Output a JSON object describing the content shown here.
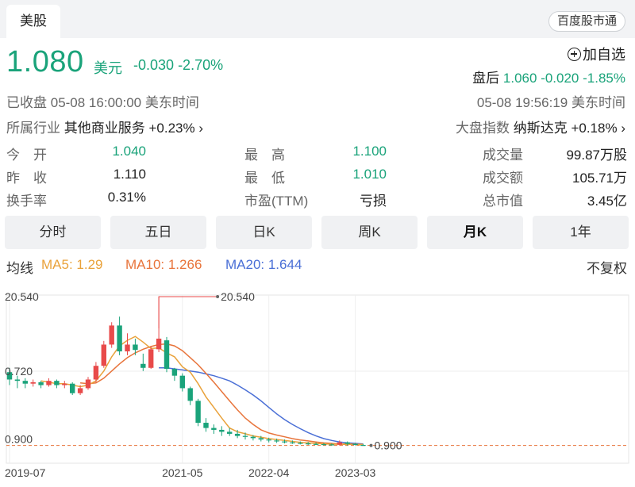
{
  "header": {
    "tab": "美股",
    "brand": "百度股市通"
  },
  "quote": {
    "price": "1.080",
    "unit": "美元",
    "change": "-0.030",
    "change_pct": "-2.70%",
    "watch_label": "加自选",
    "after_hours_label": "盘后",
    "after_hours_price": "1.060",
    "after_hours_change": "-0.020",
    "after_hours_pct": "-1.85%",
    "status": "已收盘",
    "close_time": "05-08 16:00:00",
    "tz": "美东时间",
    "after_time": "05-08 19:56:19",
    "after_tz": "美东时间"
  },
  "industry": {
    "label": "所属行业",
    "name": "其他商业服务",
    "change": "+0.23%",
    "arrow": "›"
  },
  "market_index": {
    "label": "大盘指数",
    "name": "纳斯达克",
    "change": "+0.18%",
    "arrow": "›"
  },
  "stats": {
    "open_label": "今　开",
    "open": "1.040",
    "high_label": "最　高",
    "high": "1.100",
    "volume_label": "成交量",
    "volume": "99.87万股",
    "prev_label": "昨　收",
    "prev": "1.110",
    "low_label": "最　低",
    "low": "1.010",
    "turnover_label": "成交额",
    "turnover": "105.71万",
    "turnover_rate_label": "换手率",
    "turnover_rate": "0.31%",
    "pe_label": "市盈(TTM)",
    "pe": "亏损",
    "mcap_label": "总市值",
    "mcap": "3.45亿"
  },
  "periods": [
    {
      "label": "分时",
      "active": false
    },
    {
      "label": "五日",
      "active": false
    },
    {
      "label": "日K",
      "active": false
    },
    {
      "label": "周K",
      "active": false
    },
    {
      "label": "月K",
      "active": true
    },
    {
      "label": "1年",
      "active": false
    }
  ],
  "ma": {
    "label": "均线",
    "ma5": "MA5: 1.29",
    "ma10": "MA10: 1.266",
    "ma20": "MA20: 1.644",
    "adjust": "不复权"
  },
  "colors": {
    "up": "#e84a4a",
    "down": "#1aa37a",
    "ma5": "#e9a23b",
    "ma10": "#e8743b",
    "ma20": "#4a6fd6"
  },
  "chart_data": {
    "type": "candlestick",
    "scale": "log",
    "y_ticks": [
      "20.540",
      "0.720",
      "0.900"
    ],
    "y_tick_values": [
      20.54,
      4.3,
      0.9
    ],
    "x_ticks": [
      "2019-07",
      "2021-05",
      "2022-04",
      "2023-03"
    ],
    "x_tick_index": [
      0,
      22,
      33,
      44
    ],
    "max_label": "20.540",
    "last_label": "0.900",
    "candles": [
      {
        "o": 4.2,
        "c": 3.6,
        "h": 4.6,
        "l": 3.2
      },
      {
        "o": 3.6,
        "c": 3.5,
        "h": 3.9,
        "l": 3.0
      },
      {
        "o": 3.5,
        "c": 3.3,
        "h": 3.7,
        "l": 3.0
      },
      {
        "o": 3.3,
        "c": 3.4,
        "h": 3.6,
        "l": 3.1
      },
      {
        "o": 3.4,
        "c": 3.2,
        "h": 3.5,
        "l": 3.0
      },
      {
        "o": 3.2,
        "c": 3.5,
        "h": 3.7,
        "l": 3.1
      },
      {
        "o": 3.5,
        "c": 3.2,
        "h": 3.6,
        "l": 3.0
      },
      {
        "o": 3.2,
        "c": 3.3,
        "h": 3.5,
        "l": 3.0
      },
      {
        "o": 3.3,
        "c": 2.7,
        "h": 3.4,
        "l": 2.6
      },
      {
        "o": 2.7,
        "c": 3.0,
        "h": 3.2,
        "l": 2.6
      },
      {
        "o": 3.0,
        "c": 3.6,
        "h": 3.8,
        "l": 2.9
      },
      {
        "o": 3.6,
        "c": 4.8,
        "h": 5.2,
        "l": 3.4
      },
      {
        "o": 4.8,
        "c": 7.5,
        "h": 8.1,
        "l": 4.6
      },
      {
        "o": 7.5,
        "c": 11.2,
        "h": 12.0,
        "l": 7.0
      },
      {
        "o": 11.2,
        "c": 6.5,
        "h": 13.5,
        "l": 6.0
      },
      {
        "o": 6.5,
        "c": 7.5,
        "h": 9.5,
        "l": 6.0
      },
      {
        "o": 7.5,
        "c": 6.7,
        "h": 8.5,
        "l": 6.0
      },
      {
        "o": 5.0,
        "c": 4.6,
        "h": 6.2,
        "l": 4.3
      },
      {
        "o": 4.6,
        "c": 6.8,
        "h": 7.2,
        "l": 4.5
      },
      {
        "o": 6.8,
        "c": 8.5,
        "h": 20.54,
        "l": 6.4
      },
      {
        "o": 8.2,
        "c": 4.5,
        "h": 8.8,
        "l": 4.2
      },
      {
        "o": 4.5,
        "c": 3.9,
        "h": 4.6,
        "l": 3.5
      },
      {
        "o": 3.9,
        "c": 3.0,
        "h": 4.1,
        "l": 2.8
      },
      {
        "o": 3.0,
        "c": 2.3,
        "h": 3.1,
        "l": 2.1
      },
      {
        "o": 2.3,
        "c": 1.45,
        "h": 2.4,
        "l": 1.35
      },
      {
        "o": 1.45,
        "c": 1.3,
        "h": 1.6,
        "l": 1.2
      },
      {
        "o": 1.3,
        "c": 1.25,
        "h": 1.4,
        "l": 1.15
      },
      {
        "o": 1.25,
        "c": 1.2,
        "h": 1.35,
        "l": 1.1
      },
      {
        "o": 1.2,
        "c": 1.15,
        "h": 1.3,
        "l": 1.1
      },
      {
        "o": 1.15,
        "c": 1.1,
        "h": 1.25,
        "l": 1.05
      },
      {
        "o": 1.1,
        "c": 1.08,
        "h": 1.18,
        "l": 1.02
      },
      {
        "o": 1.08,
        "c": 1.05,
        "h": 1.12,
        "l": 1.0
      },
      {
        "o": 1.05,
        "c": 1.02,
        "h": 1.1,
        "l": 0.98
      },
      {
        "o": 1.02,
        "c": 1.0,
        "h": 1.06,
        "l": 0.96
      },
      {
        "o": 1.0,
        "c": 0.98,
        "h": 1.04,
        "l": 0.95
      },
      {
        "o": 0.98,
        "c": 0.96,
        "h": 1.02,
        "l": 0.94
      },
      {
        "o": 0.96,
        "c": 0.95,
        "h": 1.0,
        "l": 0.93
      },
      {
        "o": 0.95,
        "c": 0.94,
        "h": 0.98,
        "l": 0.92
      },
      {
        "o": 0.94,
        "c": 0.93,
        "h": 0.97,
        "l": 0.91
      },
      {
        "o": 0.93,
        "c": 0.925,
        "h": 0.96,
        "l": 0.91
      },
      {
        "o": 0.925,
        "c": 0.92,
        "h": 0.95,
        "l": 0.905
      },
      {
        "o": 0.92,
        "c": 0.915,
        "h": 0.94,
        "l": 0.9
      },
      {
        "o": 0.915,
        "c": 0.96,
        "h": 1.0,
        "l": 0.9
      },
      {
        "o": 0.96,
        "c": 0.93,
        "h": 0.98,
        "l": 0.9
      },
      {
        "o": 0.93,
        "c": 0.91,
        "h": 0.95,
        "l": 0.9
      },
      {
        "o": 0.91,
        "c": 0.905,
        "h": 0.93,
        "l": 0.9
      }
    ],
    "ma5": [
      null,
      null,
      null,
      null,
      3.5,
      3.4,
      3.3,
      3.3,
      3.2,
      3.1,
      3.2,
      3.5,
      4.3,
      5.8,
      7.3,
      8.2,
      8.9,
      7.9,
      6.9,
      7.0,
      6.3,
      5.8,
      4.7,
      4.2,
      3.3,
      2.5,
      2.0,
      1.6,
      1.3,
      1.2,
      1.15,
      1.1,
      1.07,
      1.04,
      1.02,
      1.0,
      0.98,
      0.96,
      0.95,
      0.94,
      0.93,
      0.925,
      0.92,
      0.92,
      0.92,
      0.915
    ],
    "ma10": [
      null,
      null,
      null,
      null,
      null,
      null,
      null,
      null,
      null,
      3.35,
      3.3,
      3.35,
      3.7,
      4.3,
      5.0,
      5.7,
      6.3,
      6.8,
      7.2,
      7.5,
      7.6,
      7.3,
      6.6,
      5.7,
      4.9,
      4.1,
      3.4,
      2.8,
      2.3,
      1.9,
      1.6,
      1.4,
      1.25,
      1.17,
      1.12,
      1.08,
      1.04,
      1.01,
      0.99,
      0.97,
      0.95,
      0.94,
      0.93,
      0.93,
      0.925,
      0.92
    ],
    "ma20": [
      null,
      null,
      null,
      null,
      null,
      null,
      null,
      null,
      null,
      null,
      null,
      null,
      null,
      null,
      null,
      null,
      null,
      null,
      null,
      4.6,
      4.6,
      4.5,
      4.4,
      4.3,
      4.2,
      4.05,
      3.9,
      3.7,
      3.5,
      3.2,
      2.9,
      2.6,
      2.3,
      2.0,
      1.75,
      1.55,
      1.4,
      1.28,
      1.18,
      1.1,
      1.04,
      1.0,
      0.97,
      0.95,
      0.94,
      0.93
    ]
  }
}
